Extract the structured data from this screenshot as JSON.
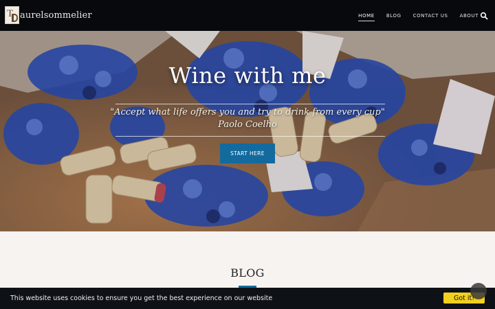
{
  "header": {
    "brand_name": "aurelsommelier",
    "logo_initial": "T",
    "nav": [
      {
        "label": "HOME",
        "active": true
      },
      {
        "label": "BLOG",
        "active": false
      },
      {
        "label": "CONTACT US",
        "active": false
      },
      {
        "label": "ABOUT",
        "active": false
      }
    ],
    "search_icon": "search-icon"
  },
  "hero": {
    "title": "Wine with me",
    "quote": "\"Accept what life offers you and try to drink from every cup\"",
    "author": "Paolo Coelho",
    "cta_label": "START HERE",
    "cta_color": "#136a9e"
  },
  "blog": {
    "heading": "BLOG",
    "accent_color": "#136a9e"
  },
  "cookie_bar": {
    "message": "This website uses cookies to ensure you get the best experience on our website",
    "button_label": "Got it!",
    "button_color": "#f2d01e"
  }
}
